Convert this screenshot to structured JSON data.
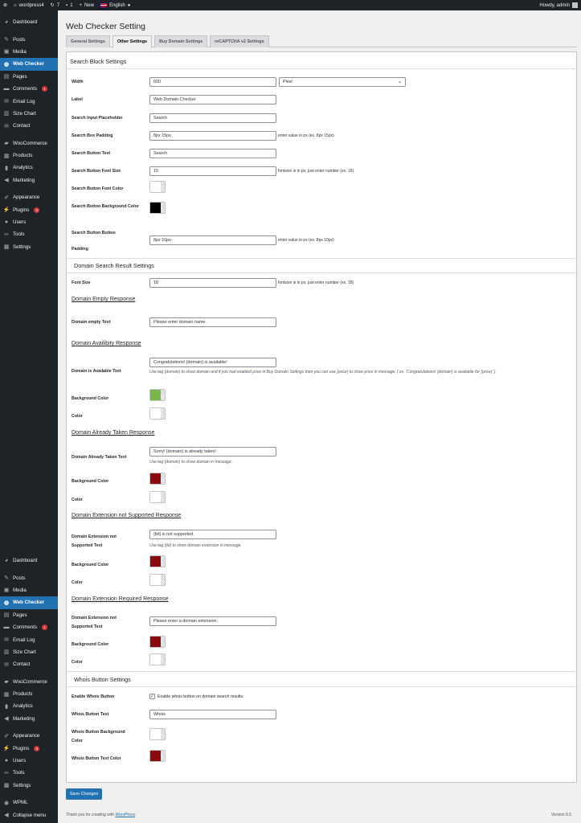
{
  "adminbar": {
    "site": "wordpress4",
    "updates": "7",
    "comments": "1",
    "new": "New",
    "language": "English",
    "howdy": "Howdy, admin"
  },
  "menu": {
    "dashboard": "Dashboard",
    "posts": "Posts",
    "media": "Media",
    "web_checker": "Web Checker",
    "pages": "Pages",
    "comments": "Comments",
    "comments_count": "1",
    "email_log": "Email Log",
    "size_chart": "Size Chart",
    "contact": "Contact",
    "woocommerce": "WooCommerce",
    "products": "Products",
    "analytics": "Analytics",
    "marketing": "Marketing",
    "appearance": "Appearance",
    "plugins": "Plugins",
    "plugins_count": "4",
    "users": "Users",
    "tools": "Tools",
    "settings": "Settings",
    "wpml": "WPML",
    "collapse": "Collapse menu"
  },
  "page": {
    "title": "Web Checker Setting"
  },
  "tabs": [
    "General Settings",
    "Other Settings",
    "Buy Domain Settings",
    "reCAPTCHA v2 Settings"
  ],
  "search_block": {
    "title": "Search Block Settings",
    "width_label": "Width",
    "width_value": "600",
    "width_unit": "Pixel",
    "label_label": "Label",
    "label_value": "Web Domain Checker",
    "placeholder_label": "Search Input Placeholder",
    "placeholder_value": "Search",
    "padding_label": "Search Box Padding",
    "padding_value": "8px 15px",
    "padding_hint": "enter value in px (ex. 8px 15px)",
    "btn_text_label": "Search Button Text",
    "btn_text_value": "Search",
    "btn_font_label": "Search Button Font Size",
    "btn_font_value": "15",
    "btn_font_hint": "fontsize is in px, just enter number (ex. 16)",
    "btn_font_color_label": "Search Button Font Color",
    "btn_bg_label": "Search Button Background Color",
    "btn_padding_label_1": "Search Button Button",
    "btn_padding_label_2": "Padding",
    "btn_padding_value": "8px 10px",
    "btn_padding_hint": "enter value in px (ex. 8px 10px)"
  },
  "result": {
    "title": "Domain Search Result Settings",
    "font_label": "Font Size",
    "font_value": "18",
    "font_hint": "fontsize is in px, just enter number (ex. 18)",
    "empty_title": "Domain Empty Response",
    "empty_label": "Domain empty Text",
    "empty_value": "Please enter domain name.",
    "avail_title": "Domain Availibity Response",
    "avail_label": "Domain is Available Text",
    "avail_value": "Congratulations! {domain} is available!",
    "avail_desc": "Use tag {domain} to show domain and if you had enabled price in Buy Domain Settings then you can use {price} to show price in message. ( ex. 'Congratulations! {domain} is available for {price}' )",
    "bg_label": "Background Color",
    "color_label": "Color",
    "taken_title": "Domain Already Taken Response",
    "taken_label": "Domain Already Taken Text",
    "taken_value": "Sorry! {domain} is already taken!",
    "taken_desc": "Use tag {domain} to show domain in message.",
    "ext_title": "Domain Extension not Supported Response",
    "ext_label_1": "Domain Extension not",
    "ext_label_2": "Supported Text",
    "ext_value": "{tld} is not supported.",
    "ext_desc": "Use tag {tld} to show domain extension in message.",
    "req_title": "Domain Extension Required Response",
    "req_label_1": "Domain Extension not",
    "req_label_2": "Supported Text",
    "req_value": "Please enter a domain extension."
  },
  "whois": {
    "title": "Whois Button Settings",
    "enable_label": "Enable Whois Button",
    "enable_text": "Enable whois button on domain search results.",
    "text_label": "Whois Button Text",
    "text_value": "Whois",
    "bg_label_1": "Whois Button Background",
    "bg_label_2": "Color",
    "color_label": "Whois Button Text Color"
  },
  "colors": {
    "white": "#ffffff",
    "black": "#000000",
    "green": "#7ab648",
    "dark_red": "#8b0a0f",
    "accent": "#2271b1"
  },
  "save": "Save Changes",
  "footer": {
    "text": "Thank you for creating with ",
    "link": "WordPress",
    "end": ".",
    "version": "Version 6.0"
  }
}
